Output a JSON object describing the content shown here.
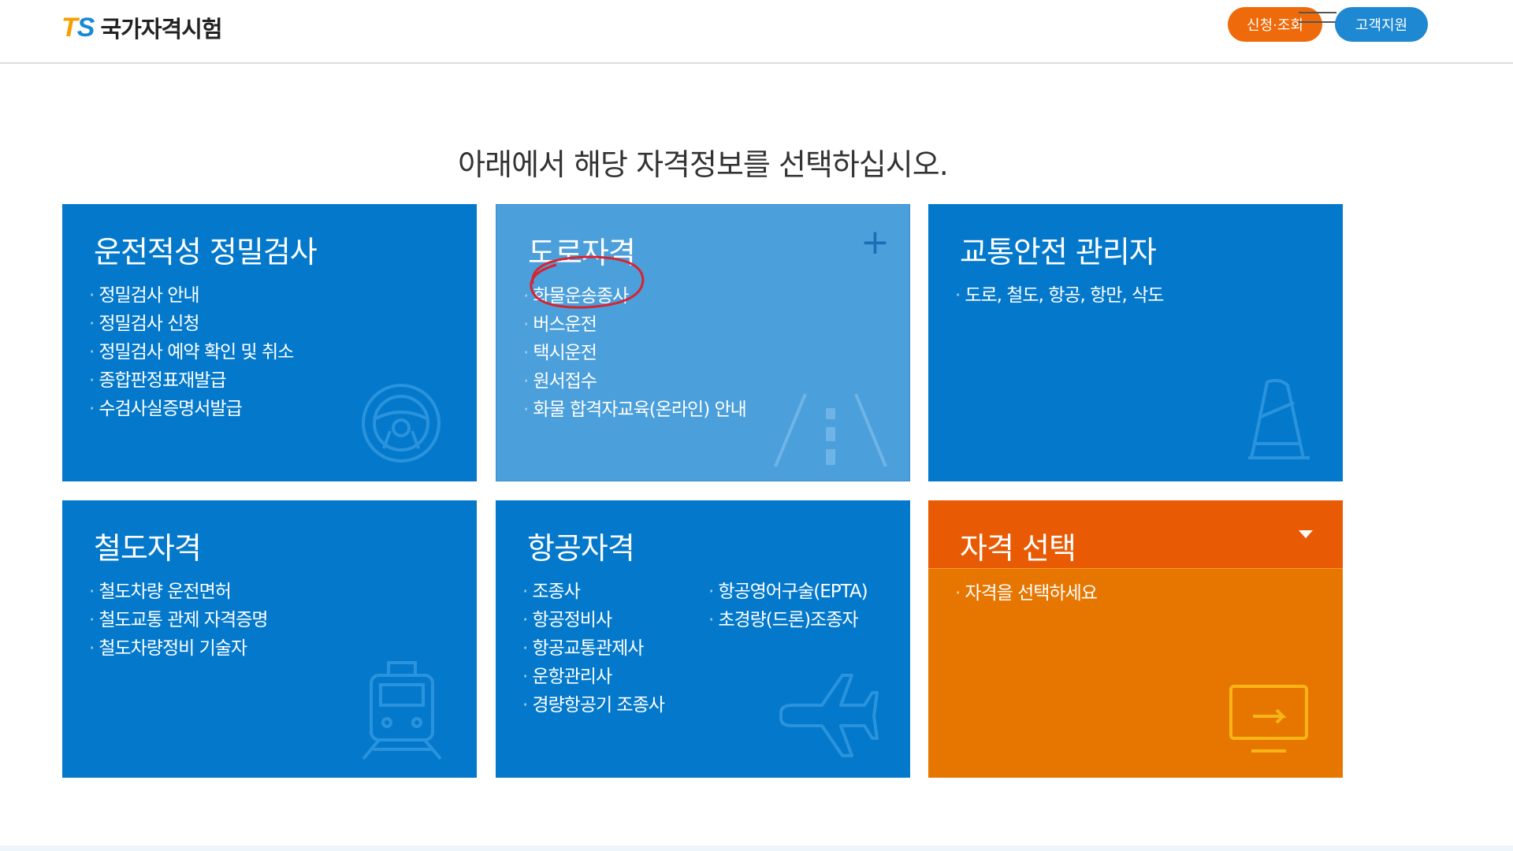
{
  "header": {
    "logo_mark_t": "T",
    "logo_mark_s": "S",
    "logo_text": "국가자격시험",
    "apply_button": "신청·조회",
    "support_button": "고객지원"
  },
  "page_title": "아래에서 해당 자격정보를 선택하십시오.",
  "cards": [
    {
      "title": "운전적성 정밀검사",
      "items": [
        "정밀검사 안내",
        "정밀검사 신청",
        "정밀검사 예약 확인 및 취소",
        "종합판정표재발급",
        "수검사실증명서발급"
      ],
      "icon": "steering-wheel-icon"
    },
    {
      "title": "도로자격",
      "items": [
        "화물운송종사",
        "버스운전",
        "택시운전",
        "원서접수",
        "화물 합격자교육(온라인) 안내"
      ],
      "icon": "road-icon",
      "plus": "+"
    },
    {
      "title": "교통안전 관리자",
      "items": [
        "도로, 철도, 항공, 항만, 삭도"
      ],
      "icon": "traffic-cone-icon"
    },
    {
      "title": "철도자격",
      "items": [
        "철도차량 운전면허",
        "철도교통 관제 자격증명",
        "철도차량정비 기술자"
      ],
      "icon": "train-icon"
    },
    {
      "title": "항공자격",
      "items": [
        "조종사",
        "항공정비사",
        "항공교통관제사",
        "운항관리사",
        "경량항공기 조종사"
      ],
      "items2": [
        "항공영어구술(EPTA)",
        "초경량(드론)조종자"
      ],
      "icon": "airplane-icon"
    },
    {
      "title": "자격 선택",
      "items": [
        "자격을 선택하세요"
      ],
      "icon": "monitor-icon"
    }
  ],
  "colors": {
    "card_blue": "#0479cc",
    "card_light_blue": "#4b9fdb",
    "card_orange": "#e77600",
    "orange_header": "#e85b04",
    "apply_orange": "#ee6a0b",
    "support_blue": "#1e88d2",
    "annotation_red": "#d9232e"
  }
}
